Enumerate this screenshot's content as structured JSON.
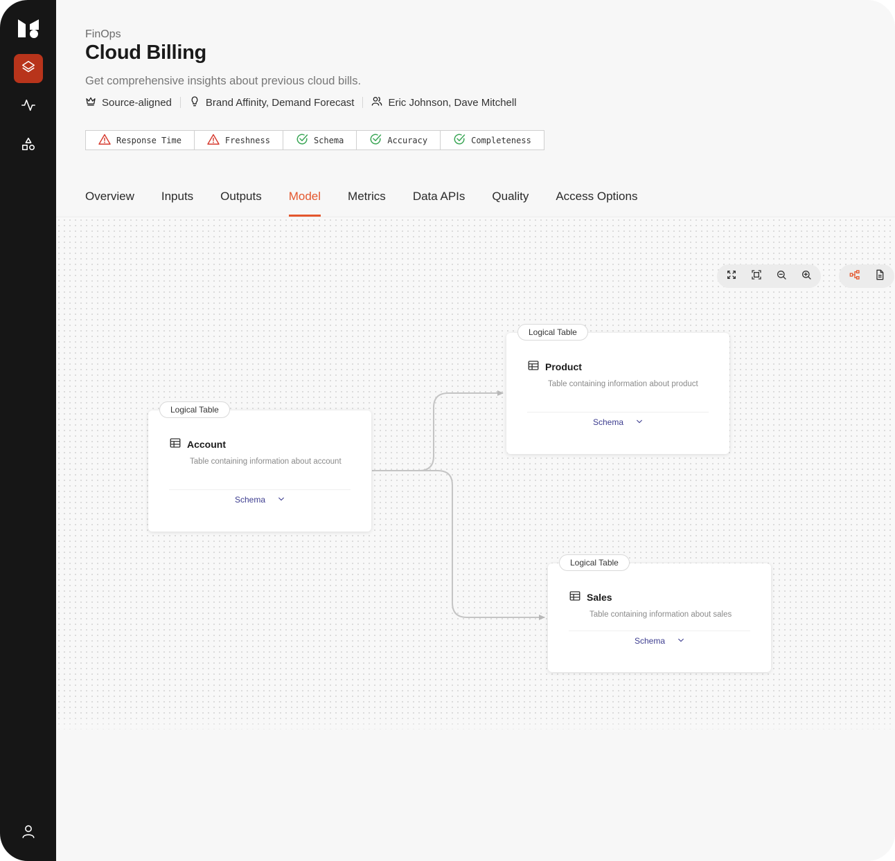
{
  "sidebar": {
    "logo": "brand-logo-icon",
    "items": [
      {
        "icon": "layers-icon",
        "active": true
      },
      {
        "icon": "activity-icon",
        "active": false
      },
      {
        "icon": "shapes-icon",
        "active": false
      }
    ],
    "footer_icon": "user-icon"
  },
  "header": {
    "breadcrumb": "FinOps",
    "title": "Cloud Billing",
    "subtitle": "Get comprehensive insights about previous cloud bills.",
    "type": "Source-aligned",
    "use_cases": "Brand Affinity, Demand Forecast",
    "owners": "Eric Johnson, Dave Mitchell"
  },
  "checks": [
    {
      "label": "Response Time",
      "status": "warning"
    },
    {
      "label": "Freshness",
      "status": "warning"
    },
    {
      "label": "Schema",
      "status": "ok"
    },
    {
      "label": "Accuracy",
      "status": "ok"
    },
    {
      "label": "Completeness",
      "status": "ok"
    }
  ],
  "tabs": [
    {
      "label": "Overview",
      "active": false
    },
    {
      "label": "Inputs",
      "active": false
    },
    {
      "label": "Outputs",
      "active": false
    },
    {
      "label": "Model",
      "active": true
    },
    {
      "label": "Metrics",
      "active": false
    },
    {
      "label": "Data APIs",
      "active": false
    },
    {
      "label": "Quality",
      "active": false
    },
    {
      "label": "Access Options",
      "active": false
    }
  ],
  "toolbar": {
    "view_controls": [
      "fullscreen-icon",
      "fit-view-icon",
      "zoom-out-icon",
      "zoom-in-icon"
    ],
    "extra_controls": [
      "hierarchy-icon",
      "document-icon"
    ]
  },
  "nodes": [
    {
      "id": "account",
      "tag": "Logical Table",
      "name": "Account",
      "description": "Table containing information about account",
      "schema_label": "Schema"
    },
    {
      "id": "product",
      "tag": "Logical Table",
      "name": "Product",
      "description": "Table containing information about product",
      "schema_label": "Schema"
    },
    {
      "id": "sales",
      "tag": "Logical Table",
      "name": "Sales",
      "description": "Table containing information about sales",
      "schema_label": "Schema"
    }
  ],
  "colors": {
    "accent": "#e4572e",
    "sidebar_bg": "#161616",
    "active_nav": "#b8341b",
    "warning": "#d63b2f",
    "ok": "#3aa655",
    "schema_link": "#3c3c8f"
  }
}
